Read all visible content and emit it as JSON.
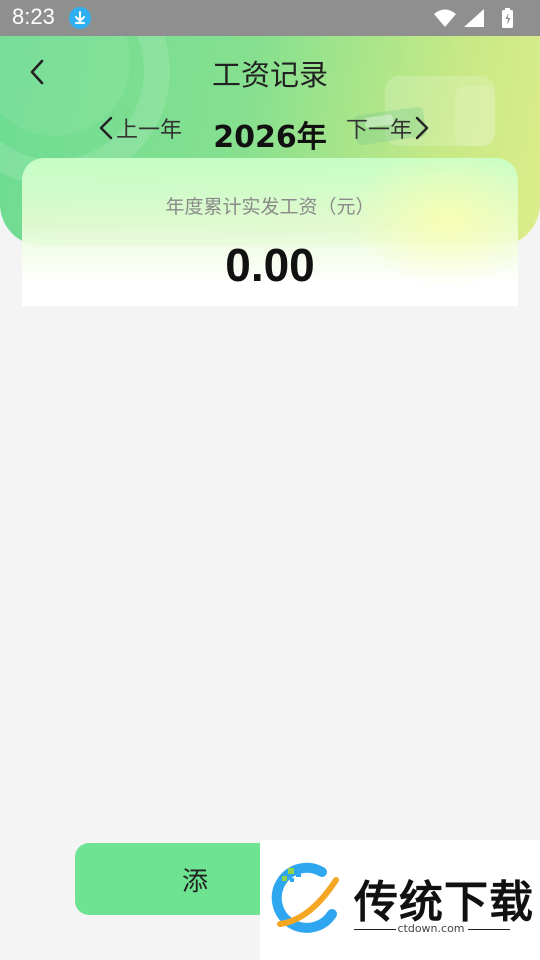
{
  "status_bar": {
    "time": "8:23"
  },
  "header": {
    "title": "工资记录"
  },
  "year_nav": {
    "prev_label": "上一年",
    "year_label": "2026年",
    "next_label": "下一年"
  },
  "summary": {
    "label": "年度累计实发工资（元）",
    "value": "0.00"
  },
  "bottom_button": {
    "label": "添"
  },
  "watermark": {
    "brand": "传统下载",
    "url": "ctdown.com"
  },
  "colors": {
    "accent_green": "#6ee391",
    "download_badge": "#2fb0f2"
  }
}
